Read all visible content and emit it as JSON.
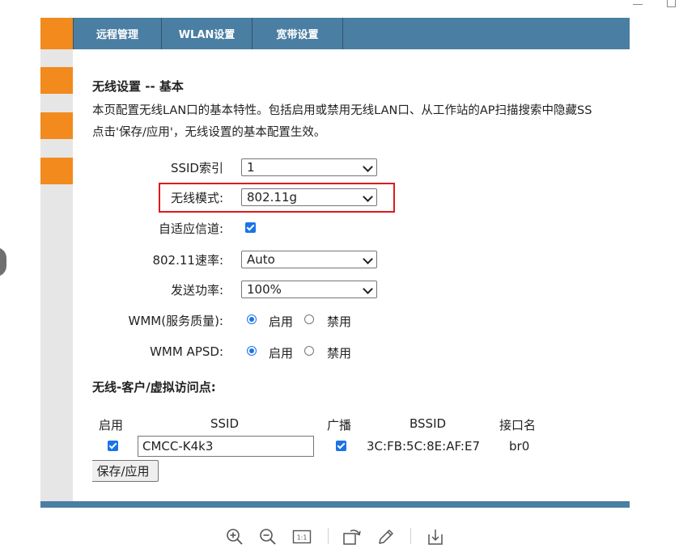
{
  "nav": {
    "tabs": [
      {
        "label": "远程管理"
      },
      {
        "label": "WLAN设置"
      },
      {
        "label": "宽带设置"
      }
    ]
  },
  "page": {
    "title": "无线设置 -- 基本",
    "desc_line1": "本页配置无线LAN口的基本特性。包括启用或禁用无线LAN口、从工作站的AP扫描搜索中隐藏SS",
    "desc_line2": "点击'保存/应用'，无线设置的基本配置生效。"
  },
  "form": {
    "ssid_index_label": "SSID索引",
    "ssid_index_value": "1",
    "wireless_mode_label": "无线模式:",
    "wireless_mode_value": "802.11g",
    "adaptive_channel_label": "自适应信道:",
    "adaptive_channel_checked": true,
    "rate_label": "802.11速率:",
    "rate_value": "Auto",
    "power_label": "发送功率:",
    "power_value": "100%",
    "wmm_label": "WMM(服务质量):",
    "wmm_apsd_label": "WMM APSD:",
    "enable_label": "启用",
    "disable_label": "禁用",
    "wmm_selected": "启用",
    "wmm_apsd_selected": "启用"
  },
  "clients": {
    "section_title": "无线-客户/虚拟访问点:",
    "headers": {
      "enable": "启用",
      "ssid": "SSID",
      "broadcast": "广播",
      "bssid": "BSSID",
      "iface": "接口名"
    },
    "rows": [
      {
        "enabled": true,
        "ssid": "CMCC-K4k3",
        "broadcast": true,
        "bssid": "3C:FB:5C:8E:AF:E7",
        "iface": "br0"
      }
    ],
    "save_label": "保存/应用"
  },
  "toolbar": {
    "icons": [
      "zoom-in-icon",
      "zoom-out-icon",
      "actual-size-icon",
      "rotate-icon",
      "edit-icon",
      "download-icon"
    ],
    "actual_size_text": "1:1"
  },
  "colors": {
    "accent_orange": "#f28a1d",
    "nav_blue": "#4a7ea2",
    "highlight_red": "#e0181c",
    "control_blue": "#1a73e8"
  }
}
